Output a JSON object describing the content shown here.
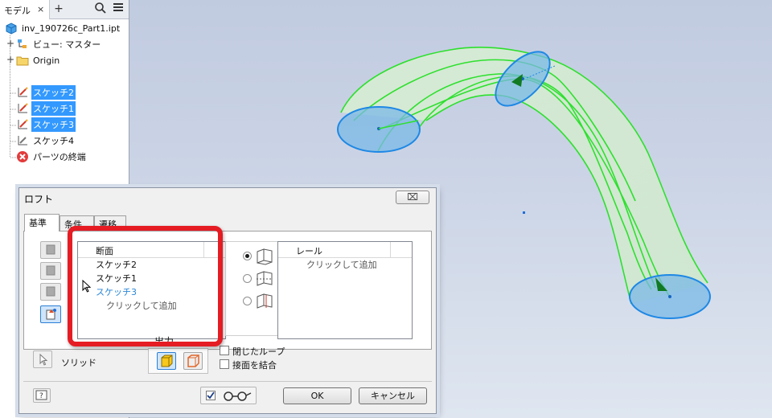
{
  "browser": {
    "tab_label": "モデル",
    "tab_close": "×",
    "add_tab": "+",
    "tree": [
      {
        "label": "inv_190726c_Part1.ipt",
        "icon": "part-file-icon",
        "selected": false
      },
      {
        "label": "ビュー: マスター",
        "icon": "view-rep-icon",
        "selected": false
      },
      {
        "label": "Origin",
        "icon": "folder-icon",
        "selected": false
      },
      {
        "label": "スケッチ2",
        "icon": "sketch-icon",
        "selected": true
      },
      {
        "label": "スケッチ1",
        "icon": "sketch-icon",
        "selected": true
      },
      {
        "label": "スケッチ3",
        "icon": "sketch-icon",
        "selected": true
      },
      {
        "label": "スケッチ4",
        "icon": "sketch-icon",
        "selected": false
      },
      {
        "label": "パーツの終端",
        "icon": "end-of-part-icon",
        "selected": false
      }
    ]
  },
  "loft": {
    "title": "ロフト",
    "close": "⌧",
    "tabs": [
      "基準",
      "条件",
      "遷移"
    ],
    "sections": {
      "header": "断面",
      "items": [
        "スケッチ2",
        "スケッチ1",
        "スケッチ3"
      ],
      "add_hint": "クリックして追加"
    },
    "rails": {
      "header": "レール",
      "add_hint": "クリックして追加"
    },
    "output_label": "出力",
    "solid_label": "ソリッド",
    "closed_loop_label": "閉じたループ",
    "merge_tangent_label": "接面を結合",
    "ok_label": "OK",
    "cancel_label": "キャンセル"
  },
  "colors": {
    "selection": "#3399ff",
    "highlight_frame": "#e51c24",
    "loft_edges": "#2de02d",
    "profile_fill": "#7ab8e6"
  }
}
